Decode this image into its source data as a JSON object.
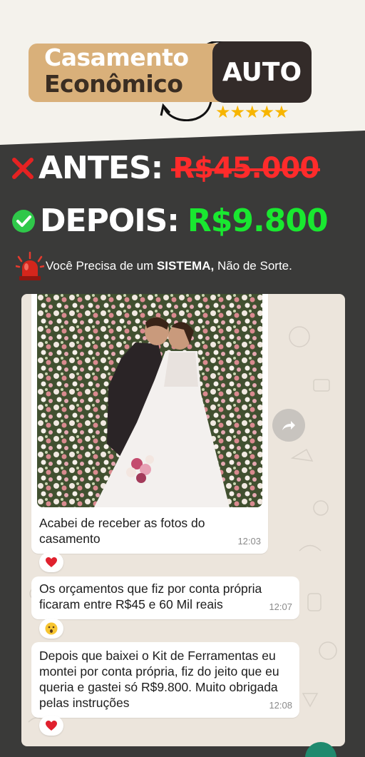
{
  "brand": {
    "line1": "Casamento",
    "line2": "Econômico",
    "badge": "AUTO",
    "stars": "★★★★★",
    "colors": {
      "tan": "#d9b07a",
      "dark": "#332b29",
      "star": "#f7b500"
    }
  },
  "prices": {
    "before_label": "ANTES:",
    "before_value": "R$45.000",
    "after_label": "DEPOIS:",
    "after_value": "R$9.800",
    "colors": {
      "before": "#ff2b2b",
      "after": "#19e830"
    }
  },
  "tagline": {
    "prefix": "Você Precisa de um ",
    "bold": "SISTEMA,",
    "suffix": " Não de Sorte."
  },
  "chat": {
    "messages": [
      {
        "text": "Acabei de receber as fotos do casamento",
        "time": "12:03",
        "reaction": "heart"
      },
      {
        "text": "Os orçamentos que fiz por conta própria ficaram entre R$45 e 60 Mil reais",
        "time": "12:07",
        "reaction": "surprised"
      },
      {
        "text": "Depois que baixei o Kit de Ferramentas eu montei por conta própria, fiz do jeito que eu queria e gastei só R$9.800. Muito obrigada pelas instruções",
        "time": "12:08",
        "reaction": "heart"
      }
    ]
  }
}
